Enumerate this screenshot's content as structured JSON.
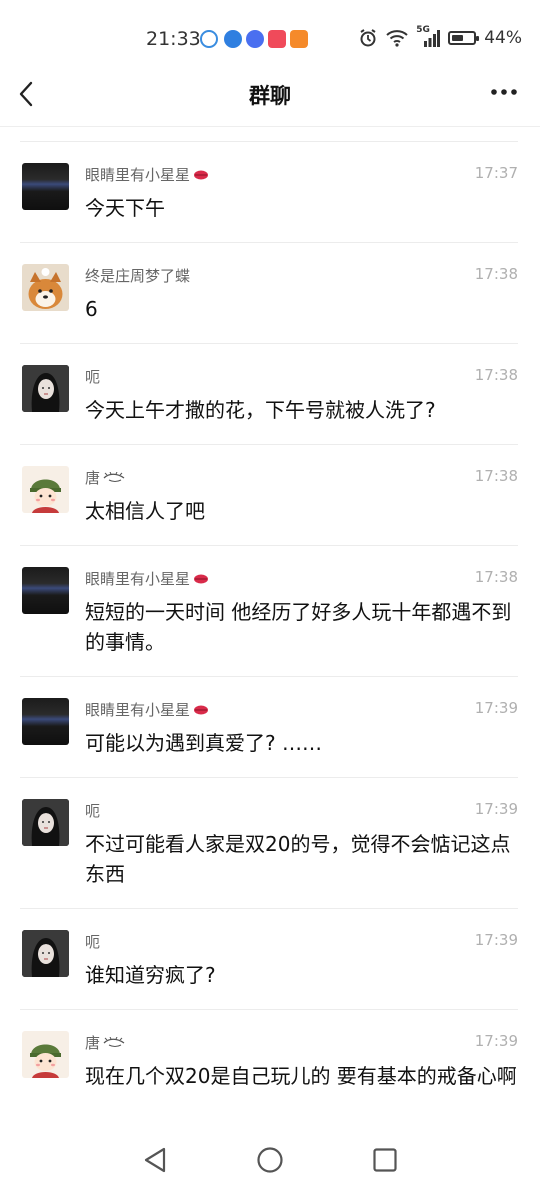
{
  "status": {
    "time": "21:33",
    "battery": "44%",
    "network": "5G"
  },
  "header": {
    "title": "群聊"
  },
  "messages": [
    {
      "name": "眼睛里有小星星",
      "time": "17:37",
      "text": "今天下午",
      "avatar": "dark"
    },
    {
      "name": "终是庄周梦了蝶",
      "time": "17:38",
      "text": "6",
      "avatar": "dog"
    },
    {
      "name": "呃",
      "time": "17:38",
      "text": "今天上午才撒的花，下午号就被人洗了?",
      "avatar": "girl"
    },
    {
      "name": "唐",
      "time": "17:38",
      "text": "太相信人了吧",
      "avatar": "cartoon"
    },
    {
      "name": "眼睛里有小星星",
      "time": "17:38",
      "text": "短短的一天时间 他经历了好多人玩十年都遇不到的事情。",
      "avatar": "dark"
    },
    {
      "name": "眼睛里有小星星",
      "time": "17:39",
      "text": "可能以为遇到真爱了? ……",
      "avatar": "dark"
    },
    {
      "name": "呃",
      "time": "17:39",
      "text": "不过可能看人家是双20的号，觉得不会惦记这点东西",
      "avatar": "girl"
    },
    {
      "name": "呃",
      "time": "17:39",
      "text": "谁知道穷疯了?",
      "avatar": "girl"
    },
    {
      "name": "唐",
      "time": "17:39",
      "text": "现在几个双20是自己玩儿的 要有基本的戒备心啊",
      "avatar": "cartoon"
    }
  ],
  "colors": {
    "accent": "#111111",
    "muted": "#b0b0b0",
    "divider": "#ececec",
    "lips": "#d92b4a"
  }
}
